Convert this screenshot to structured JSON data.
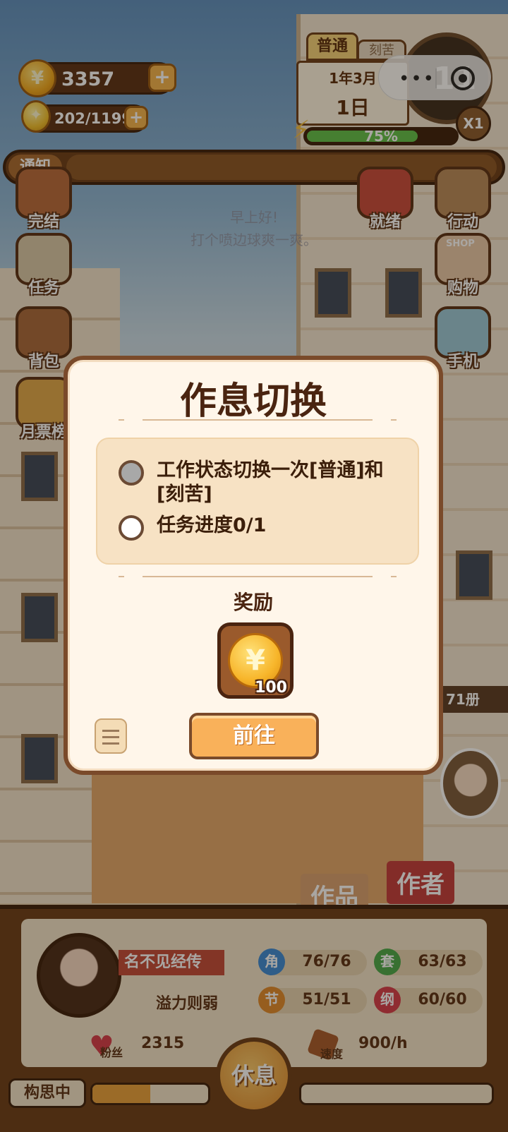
{
  "hud": {
    "coins": "3357",
    "inspiration": "202/1199",
    "calendar_mode": "普通",
    "calendar_mode_alt": "刻苦",
    "calendar_month": "1年3月",
    "calendar_day": "1日",
    "energy_percent": 75,
    "energy_label": "75%",
    "clock_time": "11",
    "speed_multiplier": "X1",
    "notice_label": "通知"
  },
  "side_menu": {
    "left": [
      "完结",
      "任务",
      "背包",
      "月票榜"
    ],
    "right": [
      "就绪",
      "行动",
      "购物",
      "手机"
    ],
    "shop_sign": "SHOP"
  },
  "background": {
    "greeting_line1": "早上好!",
    "greeting_line2": "打个喷边球爽一爽。",
    "sign_works": "作品",
    "sign_author": "作者",
    "volumes": "71册"
  },
  "modal": {
    "title": "作息切换",
    "conditions": [
      {
        "text": "工作状态切换一次[普通]和[刻苦]",
        "done": true
      },
      {
        "text": "任务进度0/1",
        "done": false
      }
    ],
    "reward_label": "奖励",
    "reward_qty": "100",
    "reward_icon": "coin-icon",
    "go_button": "前往"
  },
  "profile": {
    "name": "名不见经传",
    "title": "溢力则弱",
    "stats": [
      {
        "key": "角",
        "value": "76/76",
        "color": "#3b8ad6"
      },
      {
        "key": "套",
        "value": "63/63",
        "color": "#4aa84a"
      },
      {
        "key": "节",
        "value": "51/51",
        "color": "#e08a2a"
      },
      {
        "key": "纲",
        "value": "60/60",
        "color": "#d63a4a"
      }
    ],
    "fans_label": "粉丝",
    "fans": "2315",
    "speed_label": "速度",
    "speed": "900/h",
    "rest_button": "休息",
    "status": "构思中",
    "progress": 0.5
  }
}
